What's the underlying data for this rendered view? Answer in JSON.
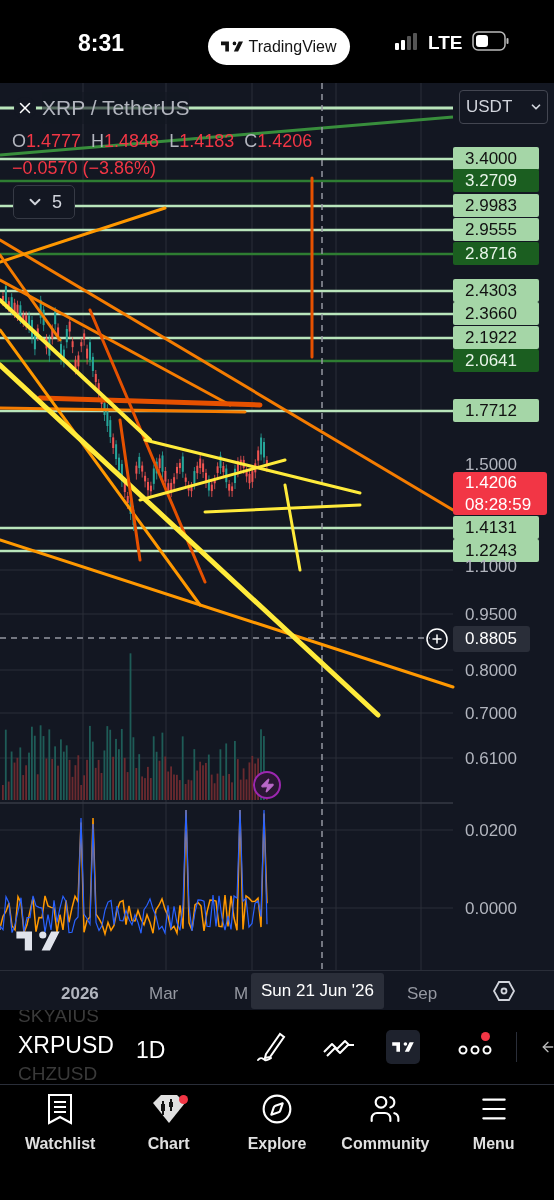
{
  "status_bar": {
    "time": "8:31",
    "app_pill": "TradingView",
    "network": "LTE"
  },
  "chart": {
    "symbol": "XRP / TetherUS",
    "currency": "USDT",
    "ohlc": [
      {
        "label": "O",
        "value": "1.4777"
      },
      {
        "label": "H",
        "value": "1.4848"
      },
      {
        "label": "L",
        "value": "1.4183"
      },
      {
        "label": "C",
        "value": "1.4206"
      }
    ],
    "change": "−0.0570 (−3.86%)",
    "indicators_count": "5",
    "price_labels": [
      {
        "text": "3.4000",
        "kind": "light"
      },
      {
        "text": "3.2709",
        "kind": "dark"
      },
      {
        "text": "2.9983",
        "kind": "light"
      },
      {
        "text": "2.9555",
        "kind": "light"
      },
      {
        "text": "2.8716",
        "kind": "dark"
      },
      {
        "text": "2.4303",
        "kind": "light"
      },
      {
        "text": "2.3660",
        "kind": "light"
      },
      {
        "text": "2.1922",
        "kind": "light"
      },
      {
        "text": "2.0641",
        "kind": "dark"
      },
      {
        "text": "1.7712",
        "kind": "light"
      },
      {
        "text": "1.5000",
        "kind": "axis"
      },
      {
        "text": "1.4206",
        "kind": "last",
        "countdown": "08:28:59"
      },
      {
        "text": "1.4131",
        "kind": "light"
      },
      {
        "text": "1.2243",
        "kind": "light"
      },
      {
        "text": "1.1000",
        "kind": "axis"
      },
      {
        "text": "0.9500",
        "kind": "axis"
      },
      {
        "text": "0.8805",
        "kind": "crosshair"
      },
      {
        "text": "0.8000",
        "kind": "axis"
      },
      {
        "text": "0.7000",
        "kind": "axis"
      },
      {
        "text": "0.6100",
        "kind": "axis"
      },
      {
        "text": "0.0200",
        "kind": "axis"
      },
      {
        "text": "0.0000",
        "kind": "axis"
      }
    ]
  },
  "time_axis": {
    "labels": [
      {
        "text": "2026",
        "kind": "year"
      },
      {
        "text": "Mar",
        "kind": "month"
      },
      {
        "text": "M",
        "kind": "month"
      },
      {
        "text": "Sep",
        "kind": "month"
      }
    ],
    "crosshair_date": "Sun 21 Jun '26"
  },
  "toolbar": {
    "symbols": [
      {
        "text": "SKYAIUS",
        "selected": false
      },
      {
        "text": "XRPUSD",
        "selected": true
      },
      {
        "text": "CHZUSD",
        "selected": false
      }
    ],
    "interval": "1D",
    "more_badge": true
  },
  "nav": [
    {
      "label": "Watchlist",
      "badge": false
    },
    {
      "label": "Chart",
      "badge": true
    },
    {
      "label": "Explore",
      "badge": false
    },
    {
      "label": "Community",
      "badge": false
    },
    {
      "label": "Menu",
      "badge": false
    }
  ]
}
